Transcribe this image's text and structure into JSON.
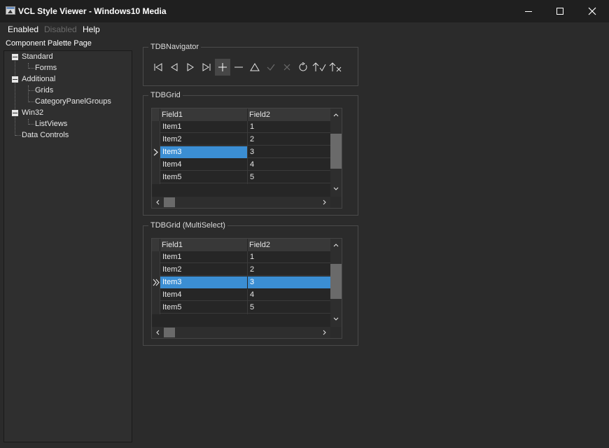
{
  "window": {
    "title": "VCL Style Viewer - Windows10 Media",
    "icon": "style-viewer-app-icon",
    "controls": [
      "minimize-icon",
      "maximize-icon",
      "close-icon"
    ]
  },
  "menu": [
    {
      "label": "Enabled",
      "disabled": false
    },
    {
      "label": "Disabled",
      "disabled": true
    },
    {
      "label": "Help",
      "disabled": false
    }
  ],
  "palette": {
    "label": "Component Palette Page",
    "tree": [
      {
        "label": "Standard",
        "level": 0,
        "expanded": true
      },
      {
        "label": "Forms",
        "level": 1
      },
      {
        "label": "Additional",
        "level": 0,
        "expanded": true
      },
      {
        "label": "Grids",
        "level": 1
      },
      {
        "label": "CategoryPanelGroups",
        "level": 1
      },
      {
        "label": "Win32",
        "level": 0,
        "expanded": true
      },
      {
        "label": "ListViews",
        "level": 1
      },
      {
        "label": "Data Controls",
        "level": 0
      }
    ]
  },
  "navigator": {
    "title": "TDBNavigator",
    "buttons": [
      "first-icon",
      "prior-icon",
      "next-icon",
      "last-icon",
      "insert-icon",
      "delete-icon",
      "edit-icon",
      "post-icon",
      "cancel-icon",
      "refresh-icon",
      "apply-updates-icon",
      "cancel-updates-icon"
    ]
  },
  "grid1": {
    "title": "TDBGrid",
    "columns": [
      "Field1",
      "Field2"
    ],
    "rows": [
      [
        "Item1",
        "1"
      ],
      [
        "Item2",
        "2"
      ],
      [
        "Item3",
        "3"
      ],
      [
        "Item4",
        "4"
      ],
      [
        "Item5",
        "5"
      ]
    ],
    "selected_row": 3,
    "selected_color": "#3b8ed3"
  },
  "grid2": {
    "title": "TDBGrid (MultiSelect)",
    "columns": [
      "Field1",
      "Field2"
    ],
    "rows": [
      [
        "Item1",
        "1"
      ],
      [
        "Item2",
        "2"
      ],
      [
        "Item3",
        "3"
      ],
      [
        "Item4",
        "4"
      ],
      [
        "Item5",
        "5"
      ]
    ],
    "selected_row": 3,
    "selected_color": "#3b8ed3"
  }
}
